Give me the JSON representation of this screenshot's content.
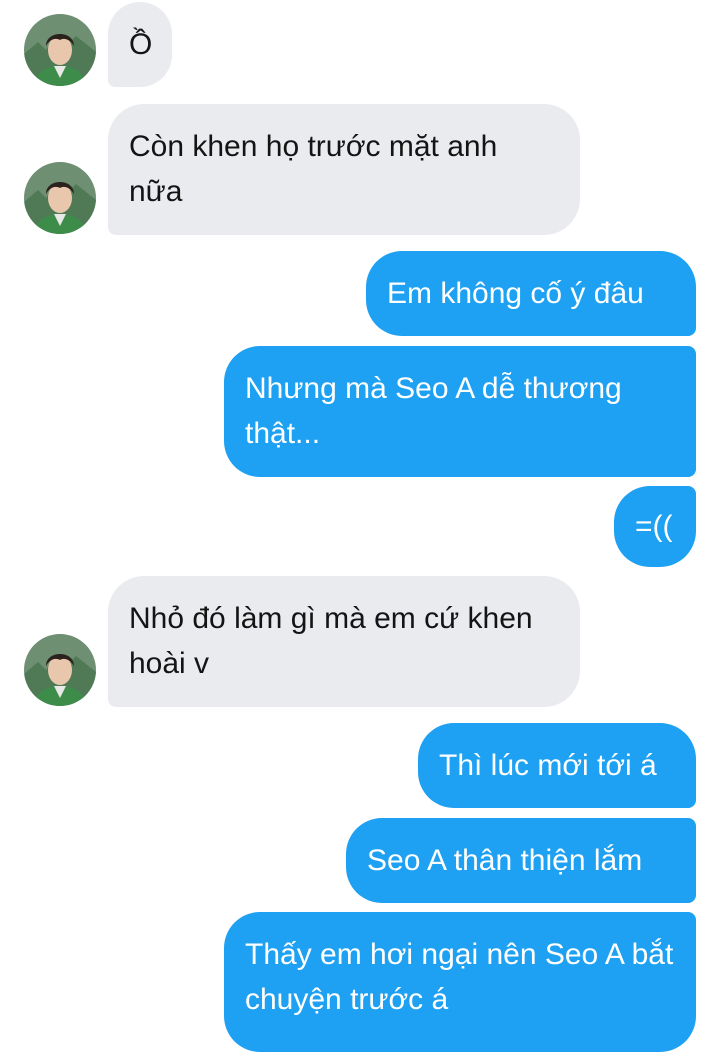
{
  "conversation": {
    "messages": [
      {
        "sender": "contact",
        "text": "Ồ"
      },
      {
        "sender": "contact",
        "text": "Còn khen họ trước mặt anh nữa"
      },
      {
        "sender": "me",
        "text": "Em không cố ý đâu"
      },
      {
        "sender": "me",
        "text": "Nhưng mà Seo A dễ thương thật..."
      },
      {
        "sender": "me",
        "text": "=(("
      },
      {
        "sender": "contact",
        "text": "Nhỏ đó làm gì mà em cứ khen hoài v"
      },
      {
        "sender": "me",
        "text": "Thì lúc mới tới á"
      },
      {
        "sender": "me",
        "text": "Seo A thân thiện lắm"
      },
      {
        "sender": "me",
        "text": "Thấy em hơi ngại nên Seo A bắt chuyện trước á"
      }
    ]
  },
  "colors": {
    "incoming_bubble": "#e9ebef",
    "outgoing_bubble": "#1ea1f2"
  }
}
